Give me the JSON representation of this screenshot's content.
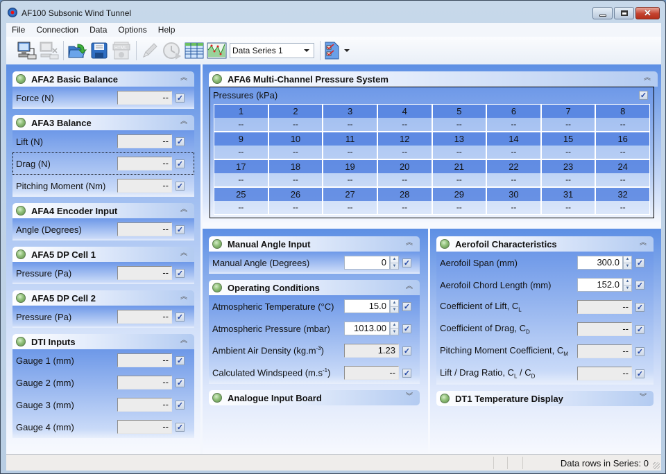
{
  "window": {
    "title": "AF100 Subsonic Wind Tunnel"
  },
  "menu": [
    "File",
    "Connection",
    "Data",
    "Options",
    "Help"
  ],
  "toolbar": {
    "buttons": [
      "connect-icon",
      "disconnect-icon",
      "open-folder-icon",
      "save-icon",
      "html-export-icon",
      "pencil-icon",
      "timer-icon",
      "table-icon",
      "chart-icon"
    ],
    "series_selected": "Data Series 1",
    "report_button": "checklist-report-icon"
  },
  "left": {
    "afa2": {
      "title": "AFA2 Basic Balance",
      "rows": [
        {
          "label": "Force  (N)",
          "value": "--"
        }
      ]
    },
    "afa3": {
      "title": "AFA3 Balance",
      "rows": [
        {
          "label": "Lift  (N)",
          "value": "--"
        },
        {
          "label": "Drag  (N)",
          "value": "--"
        },
        {
          "label": "Pitching Moment  (Nm)",
          "value": "--"
        }
      ]
    },
    "afa4": {
      "title": "AFA4 Encoder Input",
      "rows": [
        {
          "label": "Angle  (Degrees)",
          "value": "--"
        }
      ]
    },
    "afa5a": {
      "title": "AFA5 DP Cell 1",
      "rows": [
        {
          "label": "Pressure  (Pa)",
          "value": "--"
        }
      ]
    },
    "afa5b": {
      "title": "AFA5 DP Cell 2",
      "rows": [
        {
          "label": "Pressure  (Pa)",
          "value": "--"
        }
      ]
    },
    "dti": {
      "title": "DTI Inputs",
      "rows": [
        {
          "label": "Gauge 1  (mm)",
          "value": "--"
        },
        {
          "label": "Gauge 2  (mm)",
          "value": "--"
        },
        {
          "label": "Gauge 3  (mm)",
          "value": "--"
        },
        {
          "label": "Gauge 4  (mm)",
          "value": "--"
        }
      ]
    }
  },
  "afa6": {
    "title": "AFA6 Multi-Channel Pressure System",
    "subtitle": "Pressures (kPa)",
    "channels": [
      "1",
      "2",
      "3",
      "4",
      "5",
      "6",
      "7",
      "8",
      "9",
      "10",
      "11",
      "12",
      "13",
      "14",
      "15",
      "16",
      "17",
      "18",
      "19",
      "20",
      "21",
      "22",
      "23",
      "24",
      "25",
      "26",
      "27",
      "28",
      "29",
      "30",
      "31",
      "32"
    ],
    "values": [
      "--",
      "--",
      "--",
      "--",
      "--",
      "--",
      "--",
      "--",
      "--",
      "--",
      "--",
      "--",
      "--",
      "--",
      "--",
      "--",
      "--",
      "--",
      "--",
      "--",
      "--",
      "--",
      "--",
      "--",
      "--",
      "--",
      "--",
      "--",
      "--",
      "--",
      "--",
      "--"
    ]
  },
  "manual": {
    "title": "Manual Angle Input",
    "label": "Manual Angle  (Degrees)",
    "value": "0"
  },
  "operating": {
    "title": "Operating Conditions",
    "temp_label": "Atmospheric Temperature  (°C)",
    "temp_value": "15.0",
    "pressure_label": "Atmospheric Pressure  (mbar)",
    "pressure_value": "1013.00",
    "density_label": "Ambient Air Density  (kg.m",
    "density_sup": "-3",
    "density_close": ")",
    "density_value": "1.23",
    "wind_label": "Calculated Windspeed  (m.s",
    "wind_sup": "-1",
    "wind_close": ")",
    "wind_value": "--"
  },
  "analogue": {
    "title": "Analogue Input Board"
  },
  "aerofoil": {
    "title": "Aerofoil Characteristics",
    "span_label": "Aerofoil Span  (mm)",
    "span_value": "300.0",
    "chord_label": "Aerofoil Chord Length  (mm)",
    "chord_value": "152.0",
    "cl_label": "Coefficient of Lift, C",
    "cl_sub": "L",
    "cl_value": "--",
    "cd_label": "Coefficient of Drag, C",
    "cd_sub": "D",
    "cd_value": "--",
    "cm_label": "Pitching Moment Coefficient, C",
    "cm_sub": "M",
    "cm_value": "--",
    "ld_label": "Lift / Drag Ratio, C",
    "ld_sub1": "L",
    "ld_mid": " / C",
    "ld_sub2": "D",
    "ld_value": "--"
  },
  "dt1": {
    "title": "DT1 Temperature Display"
  },
  "status": {
    "text": "Data rows in Series: 0"
  }
}
